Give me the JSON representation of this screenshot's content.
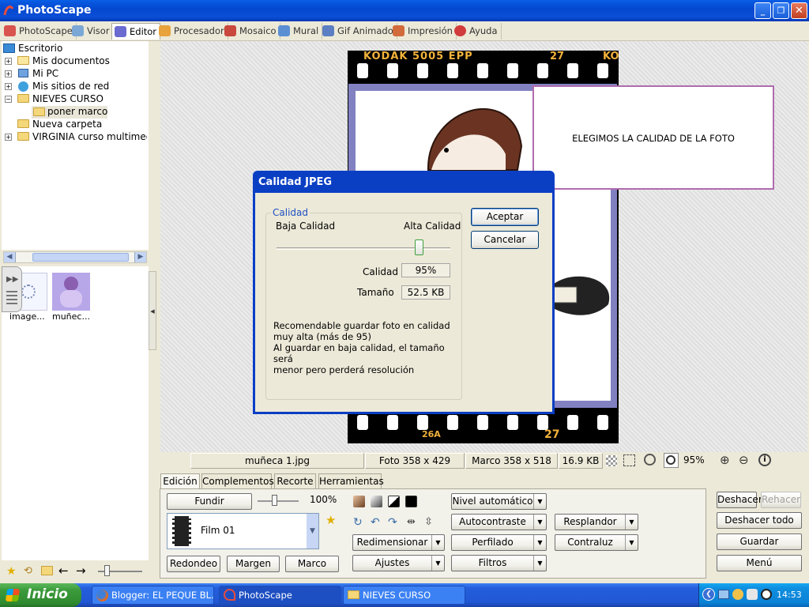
{
  "window": {
    "title": "PhotoScape",
    "minimize_glyph": "_",
    "maximize_glyph": "❐",
    "close_glyph": "✕"
  },
  "tabs": [
    {
      "label": "PhotoScape",
      "icon": "photoscape-icon",
      "color": "#d9534f"
    },
    {
      "label": "Visor",
      "icon": "viewer-icon",
      "color": "#7ba7d6"
    },
    {
      "label": "Editor",
      "icon": "editor-icon",
      "color": "#6a6ad0",
      "active": true
    },
    {
      "label": "Procesador",
      "icon": "batch-icon",
      "color": "#e8a33c"
    },
    {
      "label": "Mosaico",
      "icon": "mosaic-icon",
      "color": "#c9483d"
    },
    {
      "label": "Mural",
      "icon": "mural-icon",
      "color": "#5a8fd4"
    },
    {
      "label": "Gif Animado",
      "icon": "gif-icon",
      "color": "#5b7fc2"
    },
    {
      "label": "Impresión",
      "icon": "print-icon",
      "color": "#d26b3b"
    },
    {
      "label": "Ayuda",
      "icon": "help-icon",
      "color": "#d23b3b"
    }
  ],
  "tree": {
    "items": [
      {
        "label": "Escritorio",
        "icon": "desktop-icon"
      },
      {
        "label": "Mis documentos",
        "icon": "my-documents-icon"
      },
      {
        "label": "Mi PC",
        "icon": "my-computer-icon"
      },
      {
        "label": "Mis sitios de red",
        "icon": "network-icon"
      },
      {
        "label": "NIEVES CURSO",
        "icon": "folder-open-icon"
      },
      {
        "label": "poner marco",
        "icon": "folder-icon"
      },
      {
        "label": "Nueva carpeta",
        "icon": "folder-icon"
      },
      {
        "label": "VIRGINIA curso multimedia",
        "icon": "folder-icon"
      }
    ]
  },
  "thumbnails": [
    {
      "label": "image..."
    },
    {
      "label": "muñec..."
    }
  ],
  "film": {
    "top_left": "KODAK 5005 EPP",
    "top_number": "27",
    "top_right": "KO",
    "bottom_left": "26A",
    "bottom_right": "27"
  },
  "callout": {
    "text": "ELEGIMOS LA CALIDAD DE LA FOTO"
  },
  "dialog": {
    "title": "Calidad JPEG",
    "group_label": "Calidad",
    "low_label": "Baja Calidad",
    "high_label": "Alta Calidad",
    "quality_label": "Calidad",
    "quality_value": "95%",
    "size_label": "Tamaño",
    "size_value": "52.5 KB",
    "slider_level": 0.82,
    "note_line1": "Recomendable guardar foto en calidad",
    "note_line2": "muy alta (más de 95)",
    "note_line3": "Al guardar en baja calidad, el tamaño será",
    "note_line4": "menor pero perderá resolución",
    "ok_label": "Aceptar",
    "cancel_label": "Cancelar"
  },
  "status": {
    "filename": "muñeca 1.jpg",
    "photo_size": "Foto 358 x 429",
    "frame_size": "Marco 358 x 518",
    "file_size": "16.9 KB",
    "zoom": "95%"
  },
  "bottom_tabs": [
    "Edición",
    "Complementos",
    "Recorte",
    "Herramientas"
  ],
  "edit": {
    "fundir": "Fundir",
    "opacity": "100%",
    "frame_name": "Film 01",
    "redondeo": "Redondeo",
    "margen": "Margen",
    "marco": "Marco",
    "nivel_auto": "Nivel automático",
    "autocontraste": "Autocontraste",
    "resplandor": "Resplandor",
    "redimensionar": "Redimensionar",
    "perfilado": "Perfilado",
    "contraluz": "Contraluz",
    "ajustes": "Ajustes",
    "filtros": "Filtros"
  },
  "actions": {
    "deshacer": "Deshacer",
    "rehacer": "Rehacer",
    "deshacer_todo": "Deshacer todo",
    "guardar": "Guardar",
    "menu": "Menú"
  },
  "taskbar": {
    "start": "Inicio",
    "tasks": [
      {
        "label": "Blogger: EL PEQUE BL...",
        "icon": "firefox-icon"
      },
      {
        "label": "PhotoScape",
        "icon": "photoscape-icon"
      },
      {
        "label": "NIEVES CURSO",
        "icon": "folder-icon"
      }
    ],
    "clock": "14:53"
  }
}
